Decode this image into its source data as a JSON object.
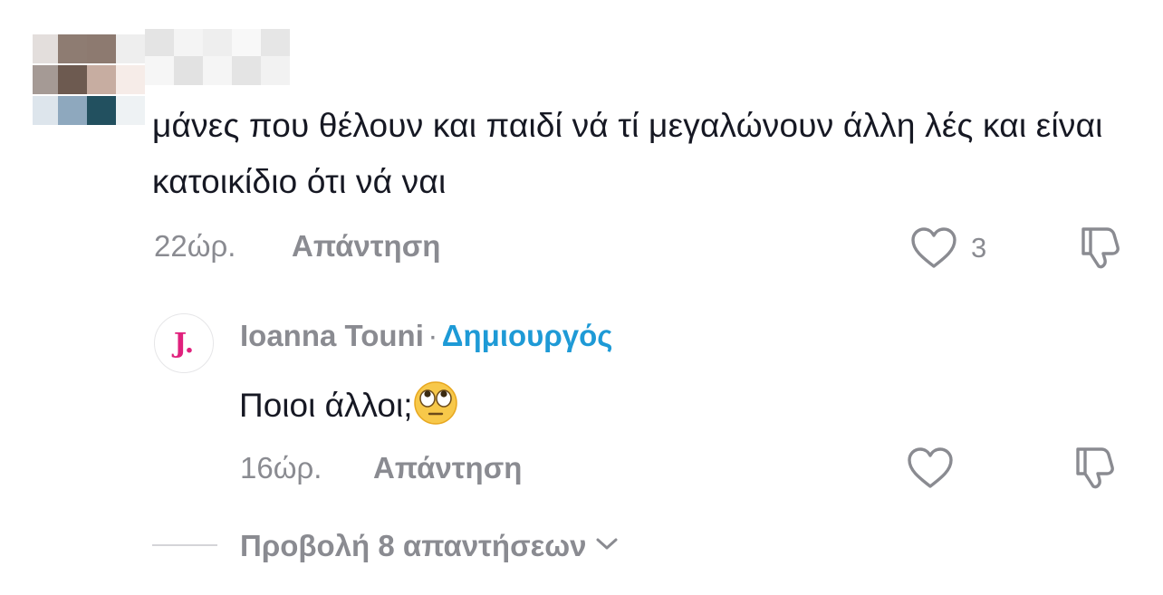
{
  "comment": {
    "text": "μάνες που θέλουν και παιδί νά τί μεγαλώνουν άλλη λές και είναι κατοικίδιο ότι νά ναι",
    "time": "22ώρ.",
    "reply_label": "Απάντηση",
    "likes": "3"
  },
  "creator_reply": {
    "avatar_letter": "J.",
    "author": "Ioanna Touni",
    "separator": "·",
    "badge": "Δημιουργός",
    "text": "Ποιοι άλλοι;",
    "emoji": "🙄",
    "time": "16ώρ.",
    "reply_label": "Απάντηση"
  },
  "view_replies": {
    "label": "Προβολή 8 απαντήσεων"
  },
  "icons": {
    "like": "heart-outline-icon",
    "dislike": "thumbs-down-icon",
    "expand": "chevron-down-icon"
  },
  "colors": {
    "text": "#161823",
    "muted": "#8a8b91",
    "creator_badge": "#1e9ad6",
    "avatar_letter": "#e0217d"
  }
}
